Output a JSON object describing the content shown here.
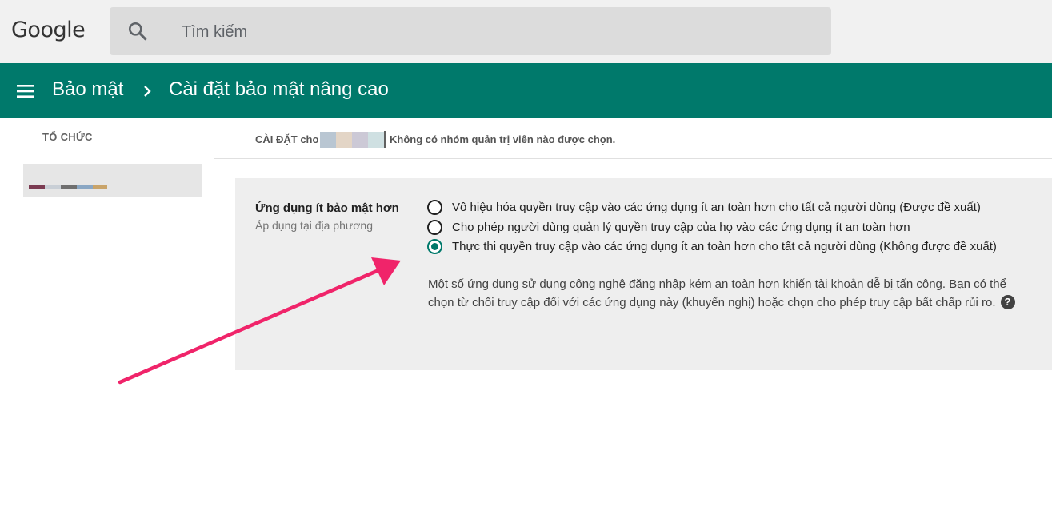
{
  "topbar": {
    "logo_text": "Google",
    "search_placeholder": "Tìm kiếm",
    "search_icon": "search-icon"
  },
  "header": {
    "menu_icon": "menu-icon",
    "breadcrumb": [
      "Bảo mật",
      "Cài đặt bảo mật nâng cao"
    ],
    "background_color": "#00796b"
  },
  "sidebar": {
    "org_label": "TỔ CHỨC",
    "selected_org_colors": [
      "#7b3b52",
      "#c9cfd6",
      "#6f6f6f",
      "#8aa7c4",
      "#c9a46a"
    ]
  },
  "settings_strip": {
    "settings_for": "CÀI ĐẶT cho",
    "ou_colors": [
      "#b9c6d2",
      "#e3d5c6",
      "#ccc9d6",
      "#cfe0e2"
    ],
    "no_admin": "Không có nhóm quản trị viên nào được chọn."
  },
  "setting": {
    "title": "Ứng dụng ít bảo mật hơn",
    "scope": "Áp dụng tại địa phương",
    "options": [
      {
        "label": "Vô hiệu hóa quyền truy cập vào các ứng dụng ít an toàn hơn cho tất cả người dùng (Được đề xuất)",
        "selected": false
      },
      {
        "label": "Cho phép người dùng quản lý quyền truy cập của họ vào các ứng dụng ít an toàn hơn",
        "selected": false
      },
      {
        "label": "Thực thi quyền truy cập vào các ứng dụng ít an toàn hơn cho tất cả người dùng (Không được đề xuất)",
        "selected": true
      }
    ],
    "description": "Một số ứng dụng sử dụng công nghệ đăng nhập kém an toàn hơn khiến tài khoản dễ bị tấn công. Bạn có thể chọn từ chối truy cập đối với các ứng dụng này (khuyến nghị) hoặc chọn cho phép truy cập bất chấp rủi ro.",
    "help_icon": "help-icon",
    "help_glyph": "?"
  },
  "annotation": {
    "arrow_color": "#f0246a"
  }
}
